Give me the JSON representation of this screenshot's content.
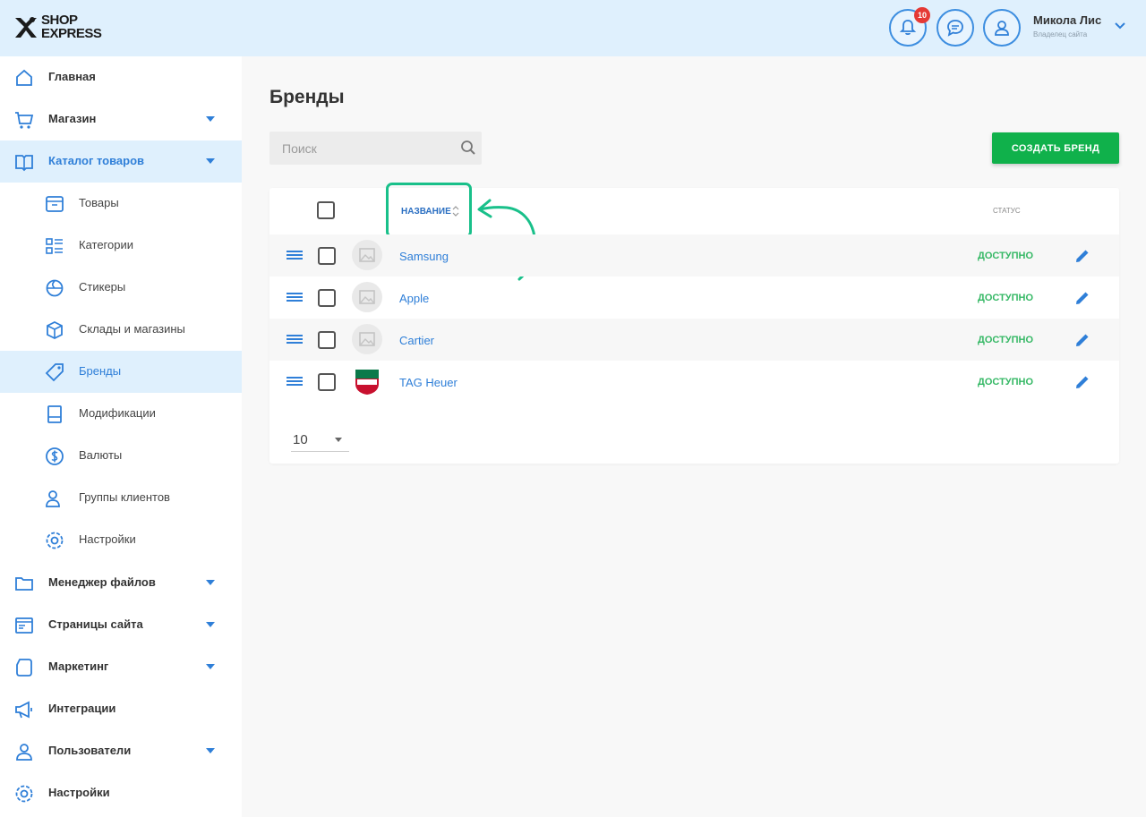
{
  "header": {
    "logo_line1": "SHOP",
    "logo_line2": "EXPRESS",
    "notification_count": "10",
    "user_name": "Микола Лис",
    "user_role": "Владелец сайта"
  },
  "sidebar": {
    "items": [
      {
        "label": "Главная",
        "icon": "home-icon"
      },
      {
        "label": "Магазин",
        "icon": "cart-icon"
      },
      {
        "label": "Каталог товаров",
        "icon": "book-icon"
      },
      {
        "label": "Товары",
        "icon": "box-icon"
      },
      {
        "label": "Категории",
        "icon": "categories-icon"
      },
      {
        "label": "Стикеры",
        "icon": "sticker-icon"
      },
      {
        "label": "Склады и магазины",
        "icon": "warehouse-icon"
      },
      {
        "label": "Бренды",
        "icon": "tag-icon"
      },
      {
        "label": "Модификации",
        "icon": "modification-icon"
      },
      {
        "label": "Валюты",
        "icon": "currency-icon"
      },
      {
        "label": "Группы клиентов",
        "icon": "user-group-icon"
      },
      {
        "label": "Настройки",
        "icon": "gear-icon"
      },
      {
        "label": "Менеджер файлов",
        "icon": "folder-icon"
      },
      {
        "label": "Страницы сайта",
        "icon": "pages-icon"
      },
      {
        "label": "Маркетинг",
        "icon": "marketing-icon"
      },
      {
        "label": "Интеграции",
        "icon": "megaphone-icon"
      },
      {
        "label": "Пользователи",
        "icon": "user-icon"
      },
      {
        "label": "Настройки",
        "icon": "gear-icon"
      }
    ]
  },
  "main": {
    "title": "Бренды",
    "search_placeholder": "Поиск",
    "create_button": "СОЗДАТЬ БРЕНД",
    "col_name": "НАЗВАНИЕ",
    "col_status": "СТАТУС",
    "rows": [
      {
        "name": "Samsung",
        "status": "ДОСТУПНО"
      },
      {
        "name": "Apple",
        "status": "ДОСТУПНО"
      },
      {
        "name": "Cartier",
        "status": "ДОСТУПНО"
      },
      {
        "name": "TAG Heuer",
        "status": "ДОСТУПНО"
      }
    ],
    "per_page": "10"
  },
  "colors": {
    "accent": "#2f7fd8",
    "header_bg": "#dff0fd",
    "create_button": "#10b14b",
    "status_available": "#35b865",
    "highlight": "#19c08a"
  }
}
